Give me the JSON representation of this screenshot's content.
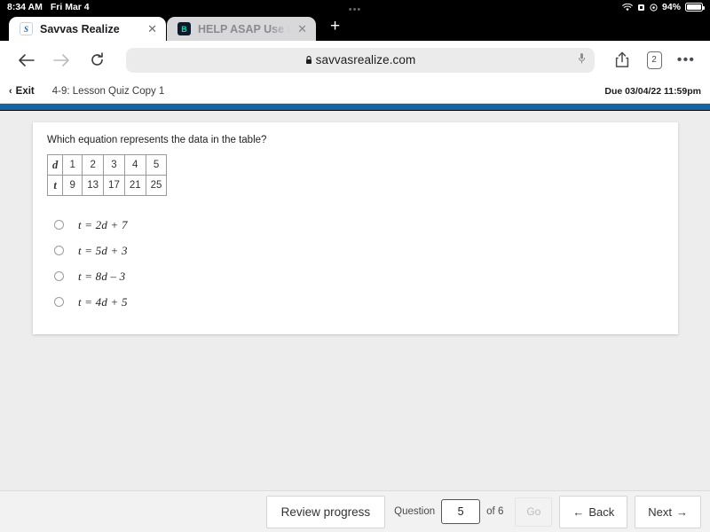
{
  "status_bar": {
    "time": "8:34 AM",
    "date": "Fri Mar 4",
    "battery_percent": "94%",
    "icons": [
      "wifi-icon",
      "alarm-icon",
      "rotation-lock-icon",
      "battery-icon"
    ]
  },
  "browser": {
    "tabs": [
      {
        "title": "Savvas Realize",
        "favicon": "S",
        "active": true,
        "close_label": "✕"
      },
      {
        "title": "HELP ASAP Use the equ",
        "favicon": "B",
        "active": false,
        "close_label": "✕"
      }
    ],
    "new_tab_label": "+",
    "toolbar": {
      "back_label": "←",
      "forward_label": "→",
      "reload_label": "↻",
      "url": "savvasrealize.com",
      "lock_icon": "lock-icon",
      "mic_icon": "microphone-icon",
      "share_icon": "share-icon",
      "tab_count": "2",
      "more_label": "•••"
    }
  },
  "app_header": {
    "exit_label": "Exit",
    "exit_chevron": "‹",
    "assignment_title": "4-9: Lesson Quiz Copy 1",
    "due_label": "Due 03/04/22 11:59pm",
    "accent_color": "#1565a4"
  },
  "question": {
    "prompt": "Which equation represents the data in the table?",
    "table": {
      "rows": [
        {
          "header": "d",
          "values": [
            "1",
            "2",
            "3",
            "4",
            "5"
          ]
        },
        {
          "header": "t",
          "values": [
            "9",
            "13",
            "17",
            "21",
            "25"
          ]
        }
      ]
    },
    "choices": [
      {
        "label": "t = 2d + 7",
        "selected": false
      },
      {
        "label": "t = 5d + 3",
        "selected": false
      },
      {
        "label": "t = 8d – 3",
        "selected": false
      },
      {
        "label": "t = 4d + 5",
        "selected": false
      }
    ]
  },
  "bottom_bar": {
    "review_label": "Review progress",
    "question_label": "Question",
    "question_value": "5",
    "of_label": "of 6",
    "go_label": "Go",
    "go_disabled": true,
    "back_label": "Back",
    "back_arrow": "←",
    "next_label": "Next",
    "next_arrow": "→"
  }
}
